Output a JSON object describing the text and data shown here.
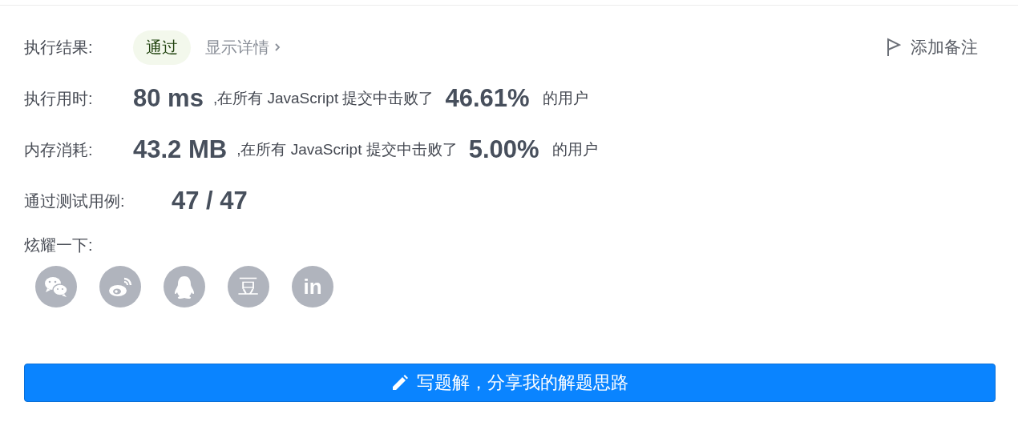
{
  "result": {
    "label": "执行结果:",
    "status": "通过",
    "details_link": "显示详情"
  },
  "add_note": "添加备注",
  "stats": [
    {
      "label": "执行用时:",
      "value": "80 ms",
      "text": ",在所有 JavaScript 提交中击败了",
      "percent": "46.61%",
      "suffix": "的用户"
    },
    {
      "label": "内存消耗:",
      "value": "43.2 MB",
      "text": ",在所有 JavaScript 提交中击败了",
      "percent": "5.00%",
      "suffix": "的用户"
    }
  ],
  "testcases": {
    "label": "通过测试用例:",
    "value": "47 / 47"
  },
  "share": {
    "label": "炫耀一下:",
    "icons": [
      {
        "kind": "wechat"
      },
      {
        "kind": "weibo"
      },
      {
        "kind": "qq"
      },
      {
        "kind": "douban",
        "glyph": "豆"
      },
      {
        "kind": "linkedin",
        "glyph": "in"
      }
    ]
  },
  "write_button": "写题解，分享我的解题思路"
}
